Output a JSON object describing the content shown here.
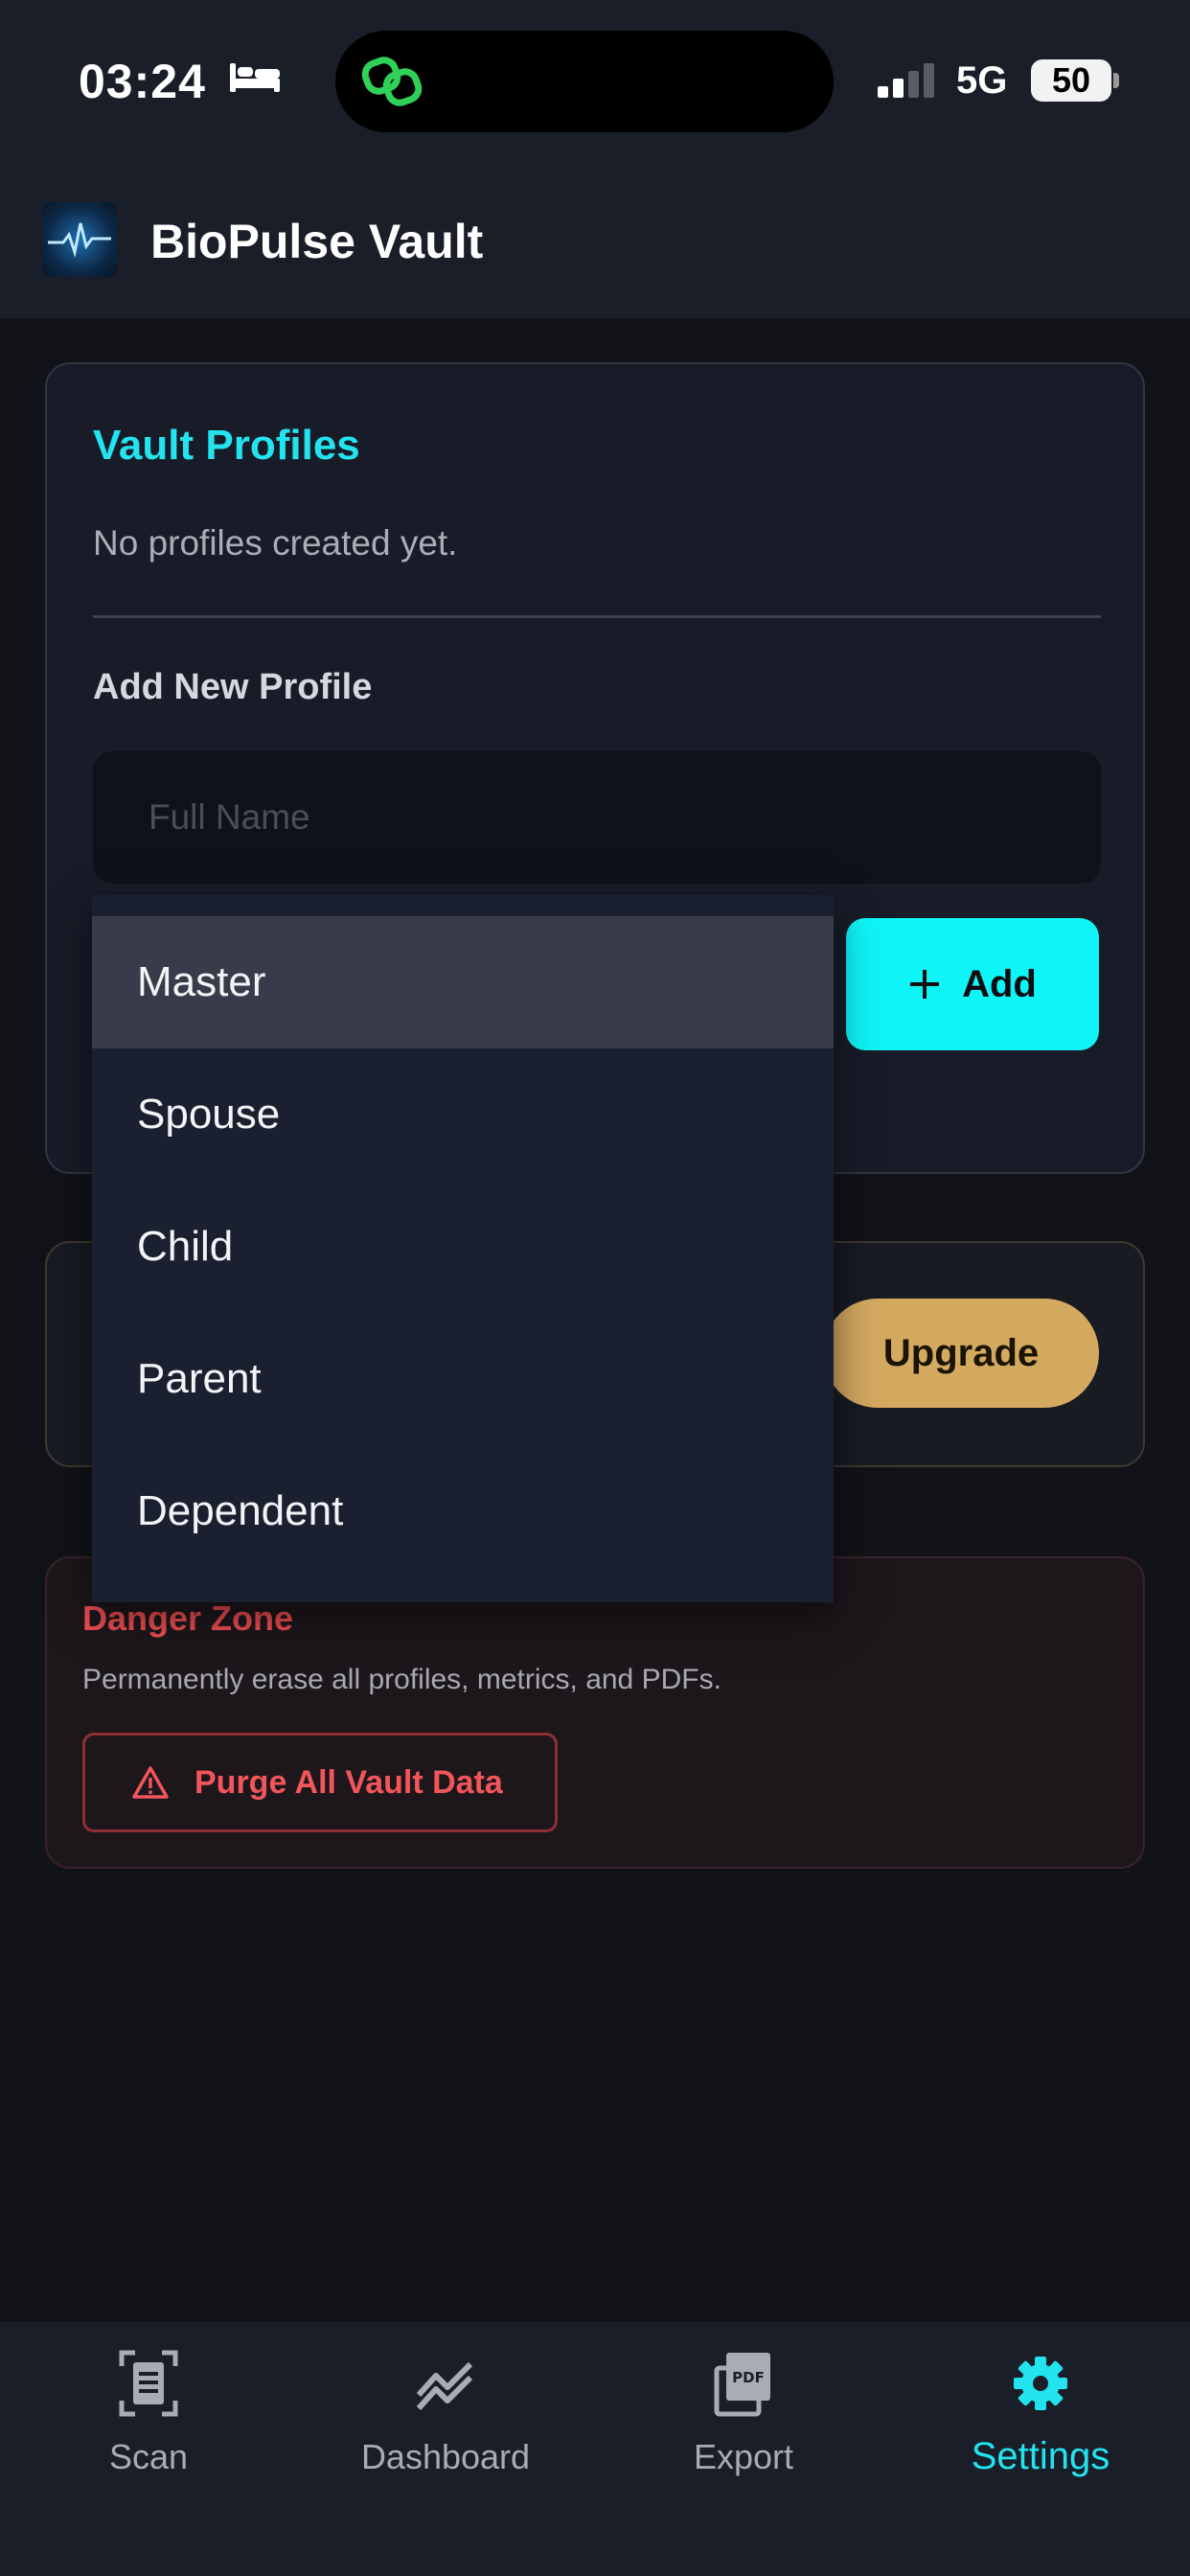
{
  "status_bar": {
    "time": "03:24",
    "network": "5G",
    "battery": "50"
  },
  "app": {
    "title": "BioPulse Vault"
  },
  "profiles": {
    "title": "Vault Profiles",
    "empty_message": "No profiles created yet.",
    "add_heading": "Add New Profile",
    "name_placeholder": "Full Name",
    "add_label": "Add",
    "selected_role": "Master"
  },
  "role_dropdown": {
    "options": [
      "Master",
      "Spouse",
      "Child",
      "Parent",
      "Dependent"
    ],
    "highlighted": "Master"
  },
  "upgrade": {
    "button_label": "Upgrade"
  },
  "danger_zone": {
    "title": "Danger Zone",
    "description": "Permanently erase all profiles, metrics, and PDFs.",
    "purge_label": "Purge All Vault Data"
  },
  "nav": {
    "items": [
      {
        "label": "Scan",
        "icon": "scan-icon"
      },
      {
        "label": "Dashboard",
        "icon": "chart-icon"
      },
      {
        "label": "Export",
        "icon": "pdf-icon"
      },
      {
        "label": "Settings",
        "icon": "gear-icon",
        "active": true
      }
    ]
  },
  "colors": {
    "accent": "#22e3ee",
    "add_button": "#0ff4f6",
    "upgrade_button": "#d4a960",
    "danger": "#f04e52",
    "background": "#121318",
    "surface": "#1a1e28"
  }
}
